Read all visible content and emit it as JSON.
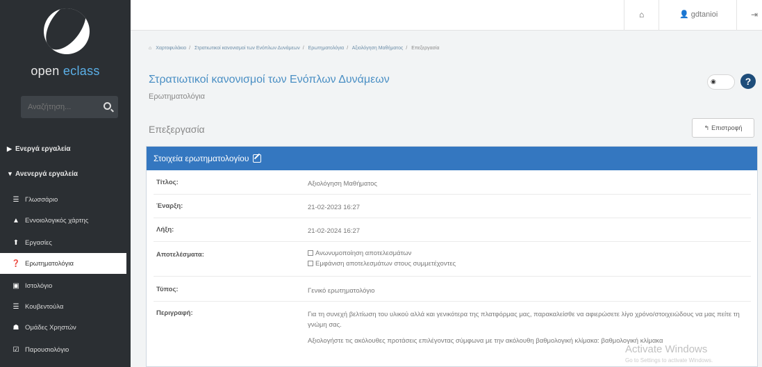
{
  "sidebar": {
    "logo_prefix": "open ",
    "logo_accent": "eclass",
    "search_placeholder": "Αναζήτηση...",
    "sections": [
      {
        "label": "Ενεργά εργαλεία"
      },
      {
        "label": "Ανενεργά εργαλεία"
      }
    ],
    "items": [
      {
        "label": "Γλωσσάριο"
      },
      {
        "label": "Εννοιολογικός χάρτης"
      },
      {
        "label": "Εργασίες"
      },
      {
        "label": "Ερωτηματολόγια"
      },
      {
        "label": "Ιστολόγιο"
      },
      {
        "label": "Κουβεντούλα"
      },
      {
        "label": "Ομάδες Χρηστών"
      },
      {
        "label": "Παρουσιολόγιο"
      }
    ]
  },
  "topbar": {
    "username": "gdtanioi"
  },
  "breadcrumb": [
    "Χαρτοφυλάκιο",
    "Στρατιωτικοί κανονισμοί των Ενόπλων Δυνάμεων",
    "Ερωτηματολόγια",
    "Αξιολόγηση Μαθήματος",
    "Επεξεργασία"
  ],
  "course": {
    "title": "Στρατιωτικοί κανονισμοί των Ενόπλων Δυνάμεων",
    "subtitle": "Ερωτηματολόγια"
  },
  "page": {
    "heading": "Επεξεργασία",
    "return_label": "Επιστροφή"
  },
  "panel": {
    "title": "Στοιχεία ερωτηματολογίου",
    "rows": {
      "title": {
        "label": "Τίτλος:",
        "value": "Αξιολόγηση Μαθήματος"
      },
      "start": {
        "label": "Έναρξη:",
        "value": "21-02-2023 16:27"
      },
      "end": {
        "label": "Λήξη:",
        "value": "21-02-2024 16:27"
      },
      "results": {
        "label": "Αποτελέσματα:",
        "opt1": "Ανωνυμοποίηση αποτελεσμάτων",
        "opt2": "Εμφάνιση αποτελεσμάτων στους συμμετέχοντες"
      },
      "type": {
        "label": "Τύπος:",
        "value": "Γενικό ερωτηματολόγιο"
      },
      "description": {
        "label": "Περιγραφή:",
        "para1": "Για τη συνεχή βελτίωση του υλικού αλλά και γενικότερα της πλατφόρμας μας, παρακαλείσθε να αφιερώσετε λίγο χρόνο/στοιχειώδους να μας πείτε τη γνώμη σας.",
        "para2": "Αξιολογήστε τις ακόλουθες προτάσεις επιλέγοντας σύμφωνα με την ακόλουθη βαθμολογική κλίμακα: βαθμολογική κλίμακα"
      }
    }
  },
  "watermark": {
    "title": "Activate Windows",
    "sub": "Go to Settings to activate Windows."
  }
}
